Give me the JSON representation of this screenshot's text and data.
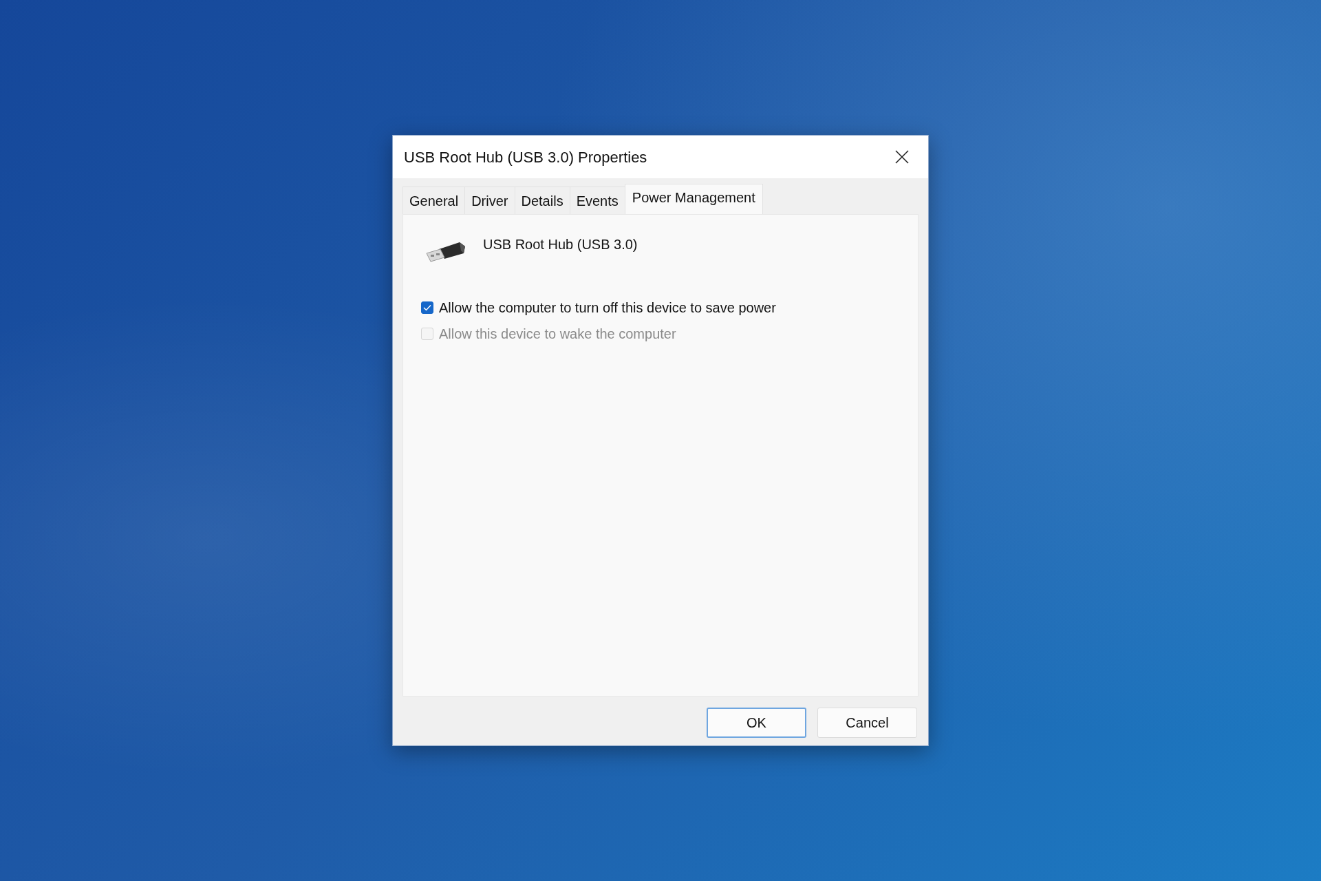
{
  "window": {
    "title": "USB Root Hub (USB 3.0) Properties"
  },
  "tabs": [
    {
      "label": "General",
      "selected": false
    },
    {
      "label": "Driver",
      "selected": false
    },
    {
      "label": "Details",
      "selected": false
    },
    {
      "label": "Events",
      "selected": false
    },
    {
      "label": "Power Management",
      "selected": true
    }
  ],
  "device": {
    "name": "USB Root Hub (USB 3.0)"
  },
  "options": [
    {
      "label": "Allow the computer to turn off this device to save power",
      "checked": true,
      "disabled": false
    },
    {
      "label": "Allow this device to wake the computer",
      "checked": false,
      "disabled": true
    }
  ],
  "buttons": [
    {
      "label": "OK",
      "default": true
    },
    {
      "label": "Cancel",
      "default": false
    }
  ]
}
